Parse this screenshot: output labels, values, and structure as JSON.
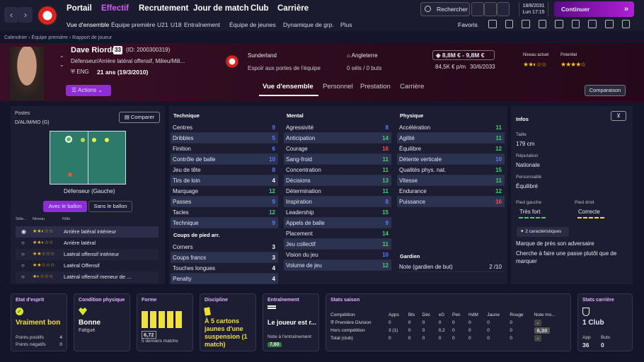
{
  "nav": {
    "menus": [
      "Portail",
      "Effectif",
      "Recrutement",
      "Jour de match",
      "Club",
      "Carrière"
    ],
    "submenus": [
      "Vue d'ensemble",
      "Équipe première",
      "U21",
      "U18",
      "Entraînement",
      "Équipe de jeunes",
      "Dynamique de grp.",
      "Plus"
    ],
    "search": "Rechercher",
    "date1": "18/8/2031",
    "date2": "Lun",
    "time": "17:15",
    "continue": "Continuer",
    "favoris": "Favoris"
  },
  "breadcrumb": [
    "Calendrier",
    "Équipe première",
    "Rapport de joueur"
  ],
  "player": {
    "name": "Dave Riordan",
    "number": "33",
    "id": "(ID: 2000300319)",
    "role": "Défenseur/Arrière latéral offensif, Milieu/Mili...",
    "nation": "ENG",
    "age": "21 ans (19/3/2010)",
    "actions": "Actions",
    "club": "Sunderland",
    "status": "Espoir aux portes de l'équipe",
    "country": "Angleterre",
    "caps": "0 séls / 0 buts",
    "value": "8,8M € - 9,8M €",
    "wage": "84,5K € p/m",
    "contract": "30/6/2033",
    "current_label": "Niveau actuel",
    "potential_label": "Potentiel",
    "current_stars": 2.5,
    "potential_stars": 4,
    "comparaison": "Comparaison"
  },
  "tabs": [
    "Vue d'ensemble",
    "Personnel",
    "Prestation",
    "Carrière"
  ],
  "positions": {
    "label": "Postes",
    "value": "D/AL/M/MO (G)",
    "compare": "Comparer",
    "pos_label": "Défenseur (Gauche)",
    "with_ball": "Avec le ballon",
    "without_ball": "Sans le ballon",
    "cols": [
      "Séle...",
      "Niveau",
      "Rôle"
    ],
    "roles": [
      {
        "name": "Arrière latéral intérieur",
        "stars": 2.5
      },
      {
        "name": "Arrière latéral",
        "stars": 2.5
      },
      {
        "name": "Latéral offensif intérieur",
        "stars": 2
      },
      {
        "name": "Latéral Offensif",
        "stars": 2
      },
      {
        "name": "Latéral offensif meneur de ...",
        "stars": 1.5
      }
    ]
  },
  "technique": {
    "title": "Technique",
    "rows": [
      [
        "Centres",
        "9",
        "b"
      ],
      [
        "Dribbles",
        "5",
        "b"
      ],
      [
        "Finition",
        "6",
        "b"
      ],
      [
        "Contrôle de balle",
        "10",
        "b"
      ],
      [
        "Jeu de tête",
        "8",
        "b"
      ],
      [
        "Tirs de loin",
        "4",
        "w"
      ],
      [
        "Marquage",
        "12",
        "g"
      ],
      [
        "Passes",
        "9",
        "b"
      ],
      [
        "Tacles",
        "12",
        "g"
      ],
      [
        "Technique",
        "9",
        "b"
      ]
    ]
  },
  "setpieces": {
    "title": "Coups de pied arr.",
    "rows": [
      [
        "Corners",
        "3",
        "w"
      ],
      [
        "Coups francs",
        "3",
        "w"
      ],
      [
        "Touches longues",
        "4",
        "w"
      ],
      [
        "Penalty",
        "4",
        "w"
      ]
    ]
  },
  "mental": {
    "title": "Mental",
    "rows": [
      [
        "Agressivité",
        "8",
        "b"
      ],
      [
        "Anticipation",
        "14",
        "g"
      ],
      [
        "Courage",
        "16",
        "r"
      ],
      [
        "Sang-froid",
        "11",
        "g"
      ],
      [
        "Concentration",
        "11",
        "g"
      ],
      [
        "Décisions",
        "13",
        "g"
      ],
      [
        "Détermination",
        "11",
        "g"
      ],
      [
        "Inspiration",
        "8",
        "b"
      ],
      [
        "Leadership",
        "15",
        "g"
      ],
      [
        "Appels de balle",
        "9",
        "b"
      ],
      [
        "Placement",
        "14",
        "g"
      ],
      [
        "Jeu collectif",
        "11",
        "g"
      ],
      [
        "Vision du jeu",
        "10",
        "b"
      ],
      [
        "Volume de jeu",
        "12",
        "g"
      ]
    ]
  },
  "physique": {
    "title": "Physique",
    "rows": [
      [
        "Accélération",
        "11",
        "g"
      ],
      [
        "Agilité",
        "11",
        "g"
      ],
      [
        "Équilibre",
        "12",
        "g"
      ],
      [
        "Détente verticale",
        "10",
        "b"
      ],
      [
        "Qualités phys. nat.",
        "15",
        "g"
      ],
      [
        "Vitesse",
        "11",
        "g"
      ],
      [
        "Endurance",
        "12",
        "g"
      ],
      [
        "Puissance",
        "16",
        "r"
      ]
    ]
  },
  "goalkeeper": {
    "title": "Gardien",
    "row": "Note (gardien de but)",
    "value": "2 /10"
  },
  "info": {
    "title": "Infos",
    "height_label": "Taille",
    "height": "179 cm",
    "rep_label": "Réputation",
    "rep": "Nationale",
    "pers_label": "Personnalité",
    "pers": "Équilibré",
    "lf_label": "Pied gauche",
    "lf": "Très fort",
    "rf_label": "Pied droit",
    "rf": "Correcte",
    "traits_btn": "2 caractéristiques",
    "trait1": "Marque de près son adversaire",
    "trait2": "Cherche à faire une passe plutôt que de marquer"
  },
  "cards": {
    "morale": {
      "t": "Etat d'esprit",
      "v": "Vraiment bon",
      "l1": "Points positifs",
      "n1": "4",
      "l2": "Points négatifs",
      "n2": "0"
    },
    "condition": {
      "t": "Condition physique",
      "v": "Bonne",
      "s": "Fatigué"
    },
    "form": {
      "t": "Forme",
      "v": "6,72",
      "s": "5 derniers matchs"
    },
    "discipline": {
      "t": "Discipline",
      "v": "À 5 cartons jaunes d'une suspension (1 match)"
    },
    "training": {
      "t": "Entraînement",
      "v": "Le joueur est r...",
      "s": "Note à l'entraînement",
      "n": "7,60"
    },
    "season": {
      "t": "Stats saison",
      "cols": [
        "Compétition",
        "Apps",
        "Bts",
        "Déc",
        "xG",
        "Pen",
        "HdM",
        "Jaune",
        "Rouge",
        "Note mo..."
      ],
      "rows": [
        [
          "Première Division",
          "0",
          "0",
          "0",
          "0",
          "0",
          "0",
          "0",
          "0",
          "-"
        ],
        [
          "Hors compétition",
          "3 (1)",
          "0",
          "0",
          "0,2",
          "0",
          "0",
          "0",
          "0",
          "6,30"
        ],
        [
          "Total (club)",
          "0",
          "0",
          "0",
          "0",
          "0",
          "0",
          "0",
          "0",
          "-"
        ]
      ]
    },
    "career": {
      "t": "Stats carrière",
      "v": "1 Club",
      "l1": "App",
      "n1": "36",
      "l2": "Buts",
      "n2": "0"
    }
  }
}
